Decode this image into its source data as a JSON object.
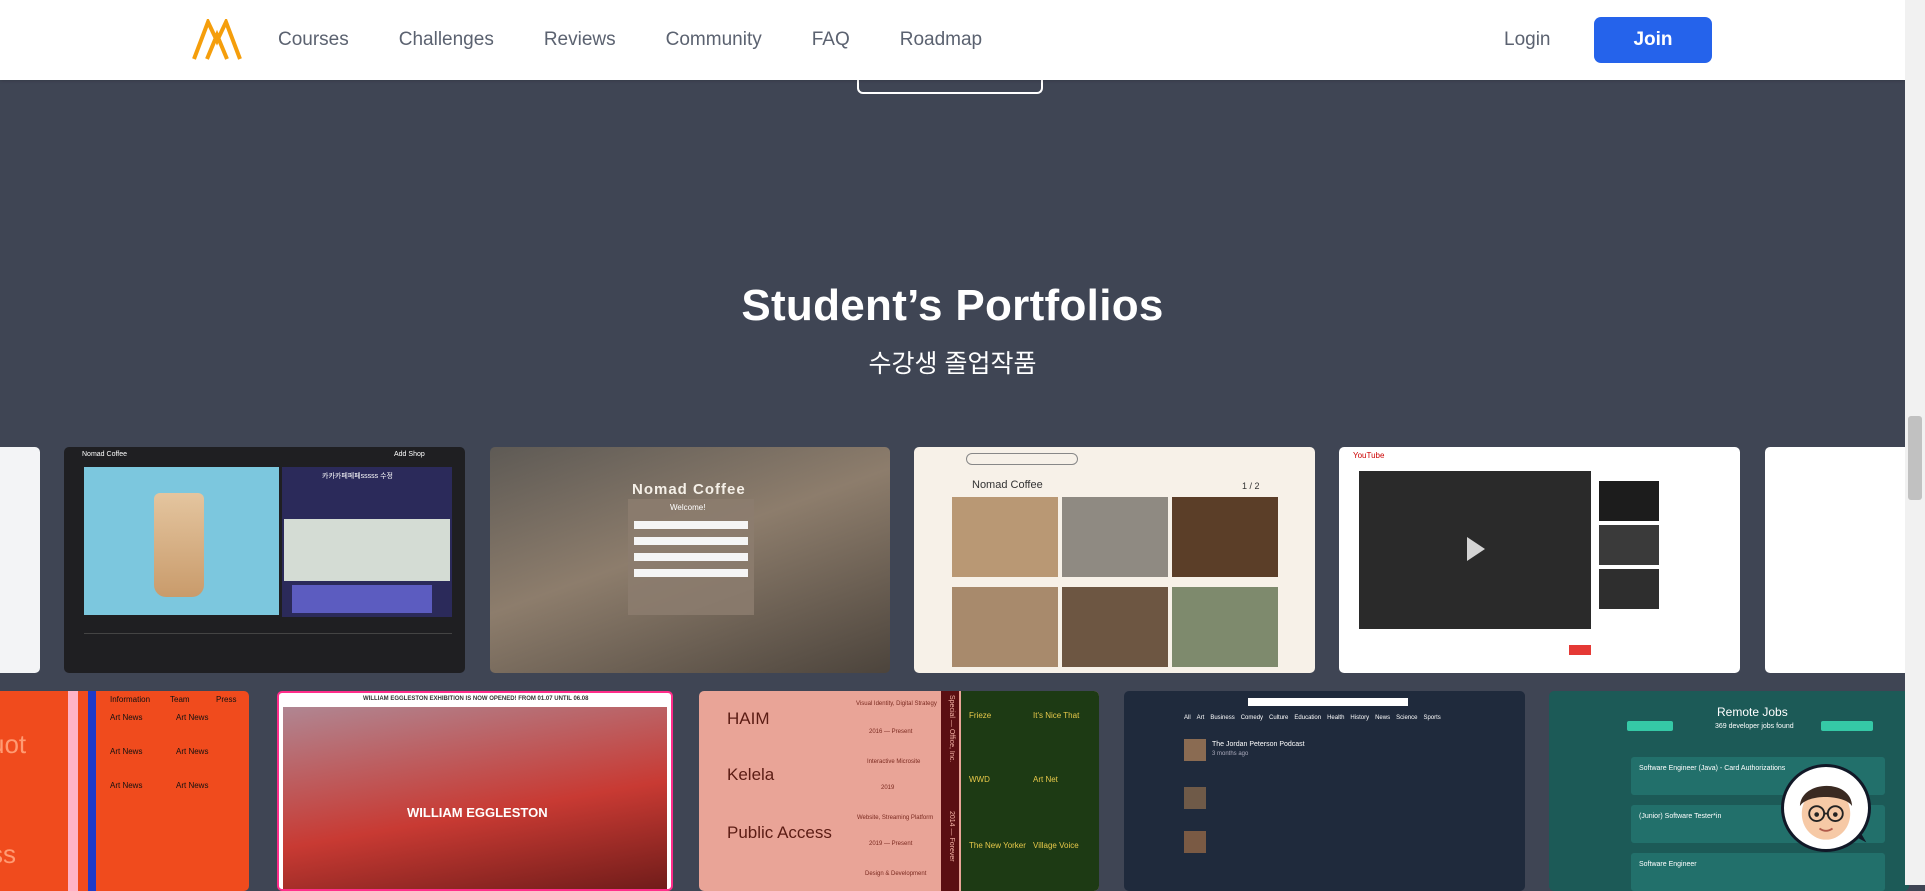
{
  "nav": {
    "links": [
      "Courses",
      "Challenges",
      "Reviews",
      "Community",
      "FAQ",
      "Roadmap"
    ],
    "login": "Login",
    "join": "Join"
  },
  "section": {
    "title": "Student’s Portfolios",
    "subtitle": "수강생 졸업작품"
  },
  "cards": {
    "coffee_menu": {
      "brand": "Nomad Coffee",
      "heading": "카카카페페페sssss 수정",
      "button": "Add Shop"
    },
    "nomad_cafe": {
      "logo": "Nomad Coffee",
      "form_title": "Welcome!"
    },
    "coffee_grid": {
      "brand": "Nomad Coffee",
      "pager": "1 / 2"
    },
    "video_app": {
      "brand": "YouTube"
    },
    "news_grid": {
      "headline": "Art News",
      "partial_left": "uot",
      "partial_bottom": "ss",
      "tabs": [
        "Information",
        "Team",
        "Press"
      ]
    },
    "eggleston": {
      "banner": "WILLIAM EGGLESTON EXHIBITION IS NOW OPENED! FROM 01.07 UNTIL 06.08",
      "name": "WILLIAM EGGLESTON"
    },
    "music_list": {
      "artists": [
        "HAIM",
        "Kelela",
        "Public Access"
      ],
      "roles": [
        "Visual Identity, Digital Strategy",
        "Interactive Microsite",
        "Website, Streaming Platform",
        "Design & Development"
      ],
      "years": [
        "2016 — Present",
        "2019",
        "2019 — Present"
      ],
      "vertical": "Special — Office, Inc.",
      "vertical2": "2014 — Forever",
      "news": [
        "Frieze",
        "It's Nice That",
        "WWD",
        "Art Net",
        "The New Yorker",
        "Village Voice"
      ]
    },
    "podcast": {
      "title": "The Jordan Peterson Podcast",
      "meta": "3 months ago",
      "tabs": [
        "All",
        "Art",
        "Business",
        "Comedy",
        "Culture",
        "Education",
        "Health",
        "History",
        "News",
        "Science",
        "Sports"
      ]
    },
    "remote_jobs": {
      "title": "Remote Jobs",
      "count": "369 developer jobs found",
      "jobs": [
        "Software Engineer (Java) - Card Authorizations",
        "(Junior) Software Tester*in",
        "Software Engineer"
      ]
    }
  },
  "colors": {
    "background": "#3f4554",
    "join_button": "#2563eb",
    "logo": "#f59e0b"
  },
  "icons": {
    "logo": "nomad-logo-icon",
    "chat": "chat-avatar-icon"
  }
}
